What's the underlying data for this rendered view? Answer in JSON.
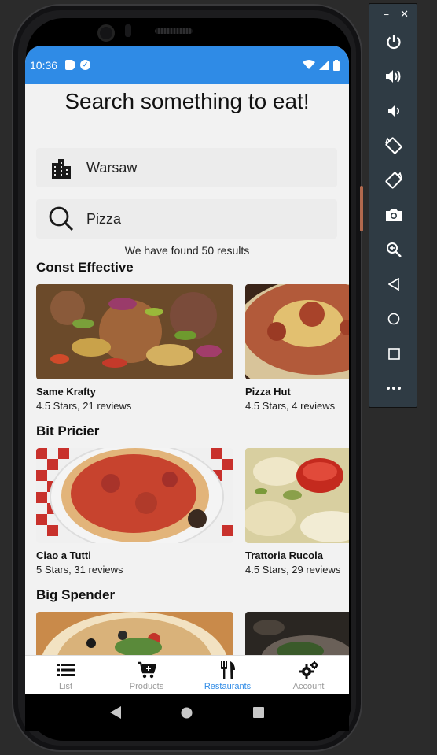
{
  "status_bar": {
    "time": "10:36",
    "icons": [
      "a-icon",
      "shield-icon",
      "sd-card-icon"
    ],
    "right_icons": [
      "wifi-icon",
      "signal-icon",
      "battery-icon"
    ]
  },
  "header": {
    "title": "Search something to eat!"
  },
  "location_field": {
    "value": "Warsaw",
    "icon": "city-icon"
  },
  "search_field": {
    "value": "Pizza",
    "icon": "search-icon"
  },
  "results_text": "We have found 50 results",
  "sections": [
    {
      "title": "Const Effective",
      "items": [
        {
          "name": "Same Krafty",
          "meta": "4.5 Stars, 21 reviews"
        },
        {
          "name": "Pizza Hut",
          "meta": "4.5 Stars, 4 reviews"
        }
      ]
    },
    {
      "title": "Bit Pricier",
      "items": [
        {
          "name": "Ciao a Tutti",
          "meta": "5 Stars, 31 reviews"
        },
        {
          "name": "Trattoria Rucola",
          "meta": "4.5 Stars, 29 reviews"
        }
      ]
    },
    {
      "title": "Big Spender",
      "items": []
    }
  ],
  "bottom_nav": [
    {
      "label": "List",
      "icon": "list-icon",
      "active": false
    },
    {
      "label": "Products",
      "icon": "cart-icon",
      "active": false
    },
    {
      "label": "Restaurants",
      "icon": "fork-knife-icon",
      "active": true
    },
    {
      "label": "Account",
      "icon": "gears-icon",
      "active": false
    }
  ],
  "colors": {
    "accent": "#2f8be6",
    "background": "#f2f2f2",
    "inactive": "#9a9a9a"
  },
  "emulator_panel": {
    "buttons": [
      "power-icon",
      "volume-up-icon",
      "volume-down-icon",
      "rotate-left-icon",
      "rotate-right-icon",
      "camera-icon",
      "zoom-icon",
      "back-icon",
      "home-icon",
      "overview-icon",
      "more-icon"
    ]
  }
}
